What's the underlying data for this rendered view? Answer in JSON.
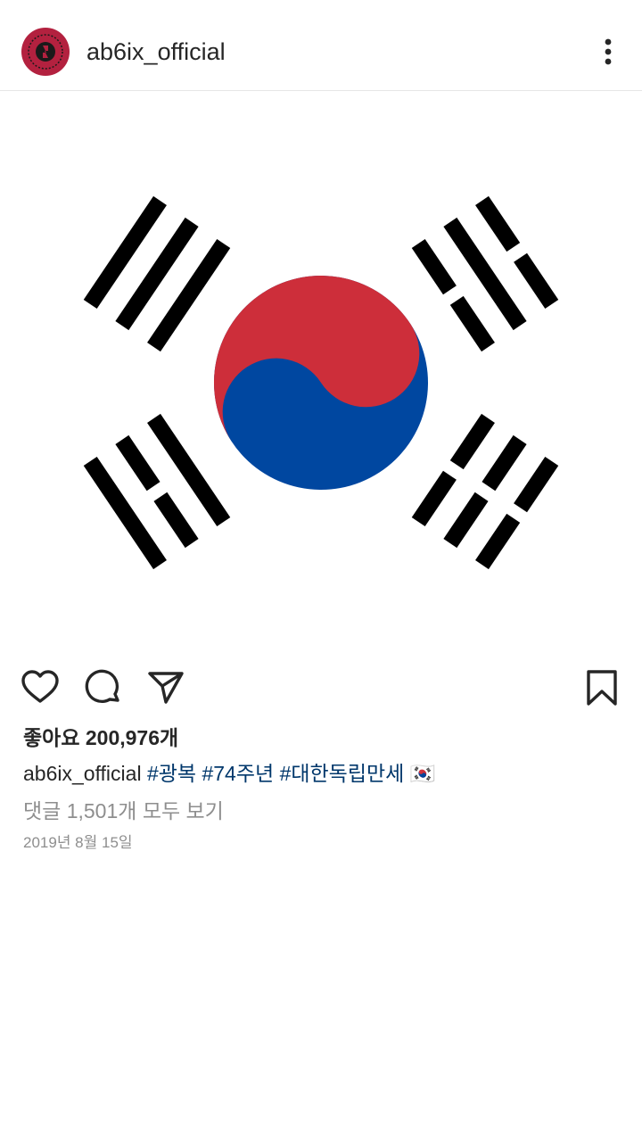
{
  "post": {
    "username": "ab6ix_official",
    "avatar_icon": "ab6ix-logo-icon",
    "image_icon": "korean-flag-taegukgi",
    "likes_text": "좋아요 200,976개",
    "caption": {
      "username": "ab6ix_official",
      "tags": [
        "#광복",
        "#74주년",
        "#대한독립만세"
      ],
      "emoji": "🇰🇷"
    },
    "comments_text": "댓글 1,501개 모두 보기",
    "date_text": "2019년 8월 15일"
  },
  "colors": {
    "avatar_bg": "#b3213f",
    "flag_red": "#cd2e3a",
    "flag_blue": "#0047a0",
    "hashtag": "#00376b",
    "muted": "#8e8e8e"
  }
}
